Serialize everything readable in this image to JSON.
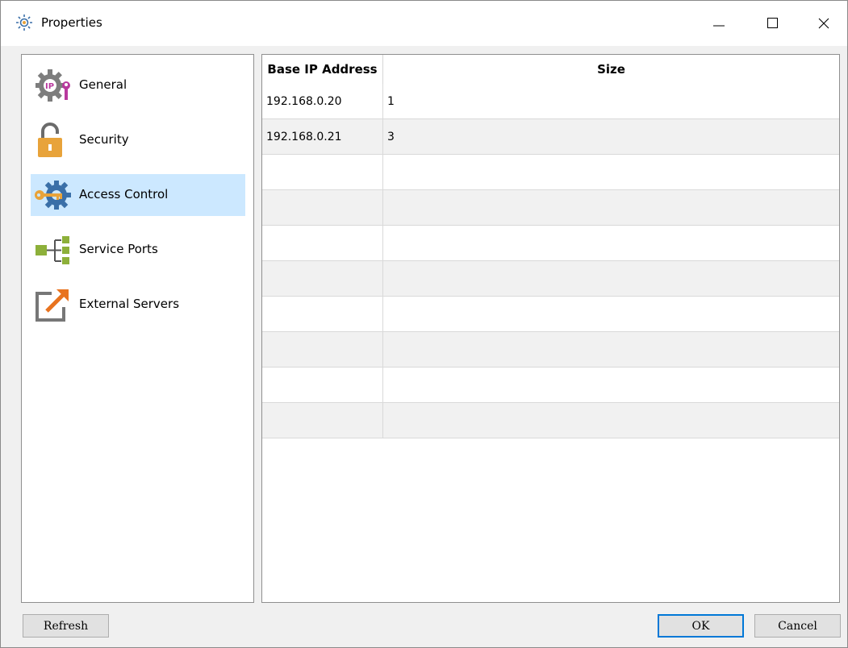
{
  "window": {
    "title": "Properties",
    "minimize_icon": "minimize-icon",
    "maximize_icon": "maximize-icon",
    "close_icon": "close-icon"
  },
  "sidebar": {
    "items": [
      {
        "label": "General",
        "icon": "ip-gear-icon",
        "selected": false
      },
      {
        "label": "Security",
        "icon": "lock-icon",
        "selected": false
      },
      {
        "label": "Access Control",
        "icon": "key-gear-icon",
        "selected": true
      },
      {
        "label": "Service Ports",
        "icon": "ports-tree-icon",
        "selected": false
      },
      {
        "label": "External Servers",
        "icon": "external-link-icon",
        "selected": false
      }
    ],
    "selected_color": "#cce8ff"
  },
  "table": {
    "columns": [
      "Base IP Address",
      "Size"
    ],
    "rows": [
      [
        "192.168.0.20",
        "1"
      ],
      [
        "192.168.0.21",
        "3"
      ],
      [
        "",
        ""
      ],
      [
        "",
        ""
      ],
      [
        "",
        ""
      ],
      [
        "",
        ""
      ],
      [
        "",
        ""
      ],
      [
        "",
        ""
      ],
      [
        "",
        ""
      ],
      [
        "",
        ""
      ]
    ]
  },
  "buttons": {
    "refresh": "Refresh",
    "ok": "OK",
    "cancel": "Cancel"
  },
  "colors": {
    "accent": "#0078d7",
    "row_alt": "#f1f1f1"
  }
}
